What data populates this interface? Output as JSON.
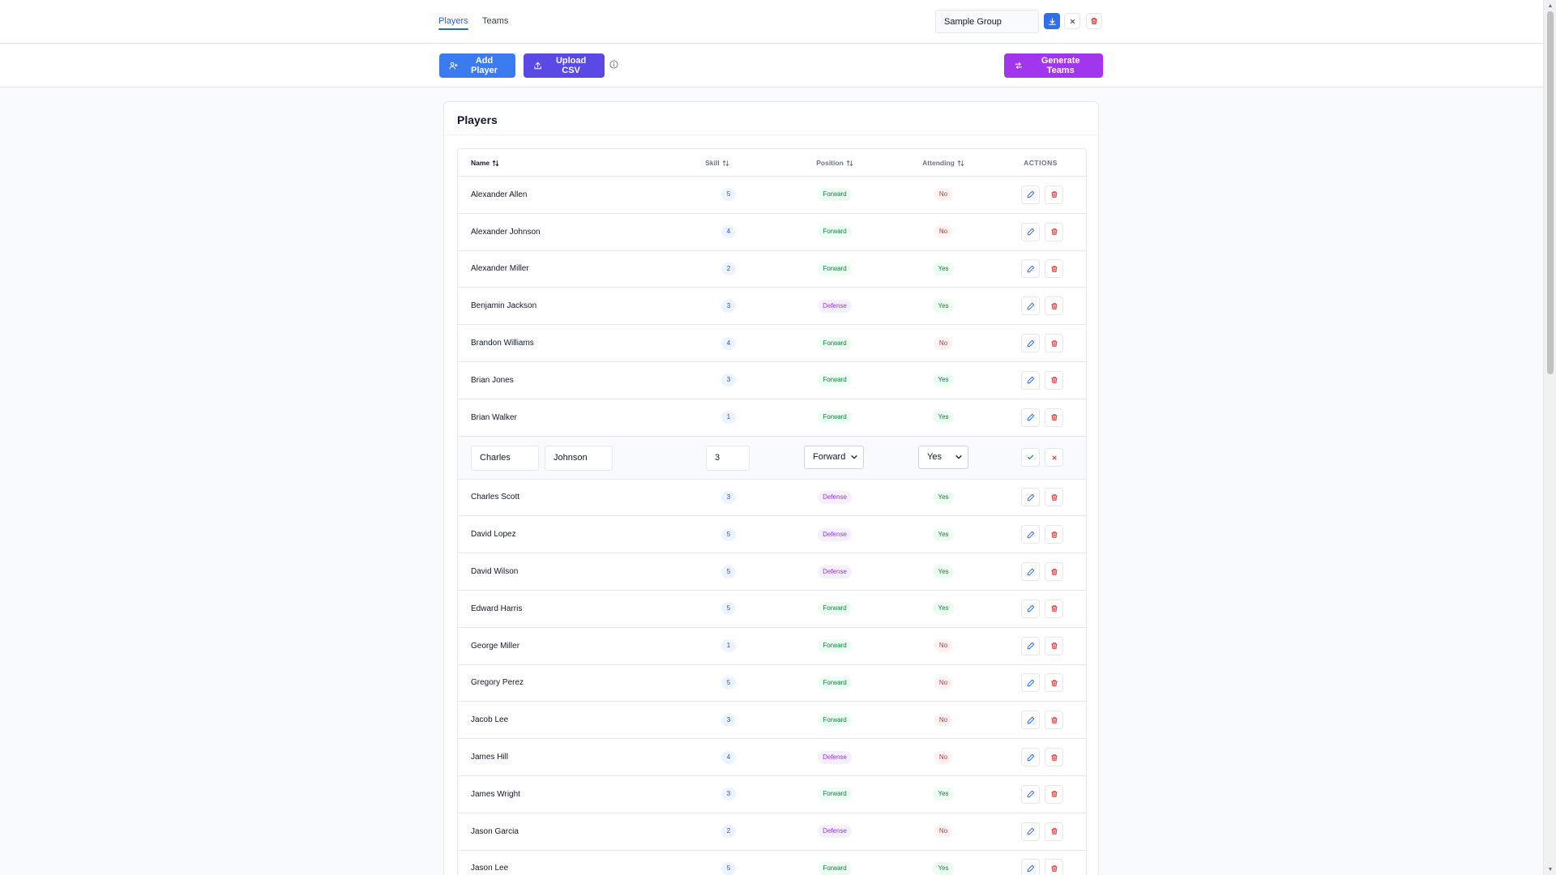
{
  "nav": {
    "tabs": [
      {
        "label": "Players",
        "active": true
      },
      {
        "label": "Teams",
        "active": false
      }
    ],
    "group_name": "Sample Group"
  },
  "toolbar": {
    "add_player": "Add Player",
    "upload_csv": "Upload CSV",
    "generate_teams": "Generate Teams"
  },
  "colors": {
    "primary": "#2563eb",
    "upload": "#5b49e6",
    "generate": "#a136ee",
    "danger": "#dc2626",
    "success": "#15803d"
  },
  "players_card": {
    "title": "Players",
    "columns": {
      "name": "Name",
      "skill": "Skill",
      "position": "Position",
      "attending": "Attending",
      "actions": "ACTIONS"
    },
    "rows": [
      {
        "name": "Alexander Allen",
        "skill": "5",
        "position": "Forward",
        "attending": "No"
      },
      {
        "name": "Alexander Johnson",
        "skill": "4",
        "position": "Forward",
        "attending": "No"
      },
      {
        "name": "Alexander Miller",
        "skill": "2",
        "position": "Forward",
        "attending": "Yes"
      },
      {
        "name": "Benjamin Jackson",
        "skill": "3",
        "position": "Defense",
        "attending": "Yes"
      },
      {
        "name": "Brandon Williams",
        "skill": "4",
        "position": "Forward",
        "attending": "No"
      },
      {
        "name": "Brian Jones",
        "skill": "3",
        "position": "Forward",
        "attending": "Yes"
      },
      {
        "name": "Brian Walker",
        "skill": "1",
        "position": "Forward",
        "attending": "Yes"
      },
      {
        "editing": true,
        "first_name": "Charles",
        "last_name": "Johnson",
        "skill": "3",
        "position": "Forward",
        "attending": "Yes"
      },
      {
        "name": "Charles Scott",
        "skill": "3",
        "position": "Defense",
        "attending": "Yes"
      },
      {
        "name": "David Lopez",
        "skill": "5",
        "position": "Defense",
        "attending": "Yes"
      },
      {
        "name": "David Wilson",
        "skill": "5",
        "position": "Defense",
        "attending": "Yes"
      },
      {
        "name": "Edward Harris",
        "skill": "5",
        "position": "Forward",
        "attending": "Yes"
      },
      {
        "name": "George Miller",
        "skill": "1",
        "position": "Forward",
        "attending": "No"
      },
      {
        "name": "Gregory Perez",
        "skill": "5",
        "position": "Forward",
        "attending": "No"
      },
      {
        "name": "Jacob Lee",
        "skill": "3",
        "position": "Forward",
        "attending": "No"
      },
      {
        "name": "James Hill",
        "skill": "4",
        "position": "Defense",
        "attending": "No"
      },
      {
        "name": "James Wright",
        "skill": "3",
        "position": "Forward",
        "attending": "Yes"
      },
      {
        "name": "Jason Garcia",
        "skill": "2",
        "position": "Defense",
        "attending": "No"
      },
      {
        "name": "Jason Lee",
        "skill": "5",
        "position": "Forward",
        "attending": "Yes"
      }
    ]
  }
}
